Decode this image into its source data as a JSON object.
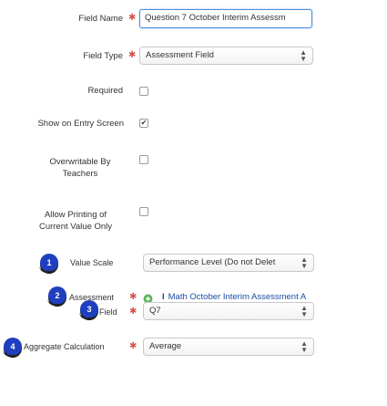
{
  "form": {
    "field_name": {
      "label": "Field Name",
      "value": "Question 7 October Interim Assessm"
    },
    "field_type": {
      "label": "Field Type",
      "value": "Assessment Field"
    },
    "required": {
      "label": "Required",
      "checked": false
    },
    "show_on_entry": {
      "label": "Show on Entry Screen",
      "checked": true,
      "check_glyph": "✔"
    },
    "overwritable": {
      "label_line1": "Overwritable By",
      "label_line2": "Teachers",
      "checked": false
    },
    "allow_printing": {
      "label_line1": "Allow Printing of",
      "label_line2": "Current Value Only",
      "checked": false
    },
    "value_scale": {
      "label": "Value Scale",
      "value": "Performance Level (Do not Delet"
    },
    "assessment": {
      "label": "Assessment",
      "value": "Math October Interim Assessment A",
      "link_prefix": "I"
    },
    "field": {
      "label": "Field",
      "value": "Q7"
    },
    "aggregate": {
      "label": "Aggregate Calculation",
      "value": "Average"
    }
  },
  "required_marker": "✱",
  "callouts": [
    "1",
    "2",
    "3",
    "4"
  ],
  "colors": {
    "required": "#d9534f",
    "badge": "#1f3fbf",
    "link": "#1a4fa3",
    "focus_border": "#4a90d9",
    "gear": "#5cb85c"
  },
  "icons": {
    "select_chevron": "chevron-updown-icon",
    "assessment_gear": "gear-icon"
  }
}
